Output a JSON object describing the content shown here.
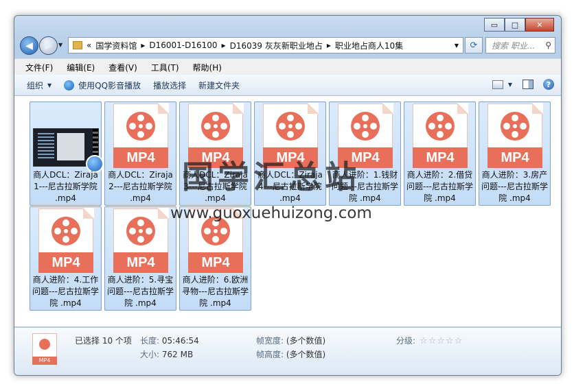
{
  "window": {
    "controls": {
      "minimize": "▭",
      "maximize": "□",
      "close": "✕"
    }
  },
  "nav": {
    "back_glyph": "◀",
    "forward_glyph": "▶",
    "breadcrumb_prefix": "«",
    "breadcrumb": [
      "国学资料馆",
      "D16001-D16100",
      "D16039 灰灰新职业地占",
      "职业地占商人10集"
    ],
    "search_placeholder": "搜索 职业...",
    "refresh_glyph": "⟳"
  },
  "menu": [
    "文件(F)",
    "编辑(E)",
    "查看(V)",
    "工具(T)",
    "帮助(H)"
  ],
  "toolbar": {
    "organize": "组织",
    "play_with_qq": "使用QQ影音播放",
    "play_selection": "播放选择",
    "new_folder": "新建文件夹"
  },
  "files": [
    {
      "label": "商人DCL：Ziraja1---尼古拉斯学院 .mp4",
      "kind": "thumbnail"
    },
    {
      "label": "商人DCL：Ziraja2---尼古拉斯学院 .mp4",
      "kind": "mp4"
    },
    {
      "label": "商人DCL：Ziraja3---尼古拉斯学院 .mp4",
      "kind": "mp4"
    },
    {
      "label": "商人DCL：Ziraja4---尼古拉斯学院 .mp4",
      "kind": "mp4"
    },
    {
      "label": "商人进阶：1.钱财问题---尼古拉斯学院 .mp4",
      "kind": "mp4"
    },
    {
      "label": "商人进阶：2.借贷问题---尼古拉斯学院 .mp4",
      "kind": "mp4"
    },
    {
      "label": "商人进阶：3.房产问题---尼古拉斯学院 .mp4",
      "kind": "mp4"
    },
    {
      "label": "商人进阶：4.工作问题---尼古拉斯学院 .mp4",
      "kind": "mp4"
    },
    {
      "label": "商人进阶：5.寻宝问题---尼古拉斯学院 .mp4",
      "kind": "mp4"
    },
    {
      "label": "商人进阶：6.欧洲寻物---尼古拉斯学院 .mp4",
      "kind": "mp4"
    }
  ],
  "file_badge": "MP4",
  "watermark": {
    "title": "国学汇总站",
    "url": "www.guoxuehuizong.com"
  },
  "details": {
    "selected": "已选择 10 个项",
    "length_label": "长度:",
    "length_value": "05:46:54",
    "size_label": "大小:",
    "size_value": "762 MB",
    "frame_width_label": "帧宽度:",
    "frame_width_value": "(多个数值)",
    "frame_height_label": "帧高度:",
    "frame_height_value": "(多个数值)",
    "rating_label": "分级:",
    "rating_stars": "☆☆☆☆☆",
    "icon_badge": "MP4"
  }
}
